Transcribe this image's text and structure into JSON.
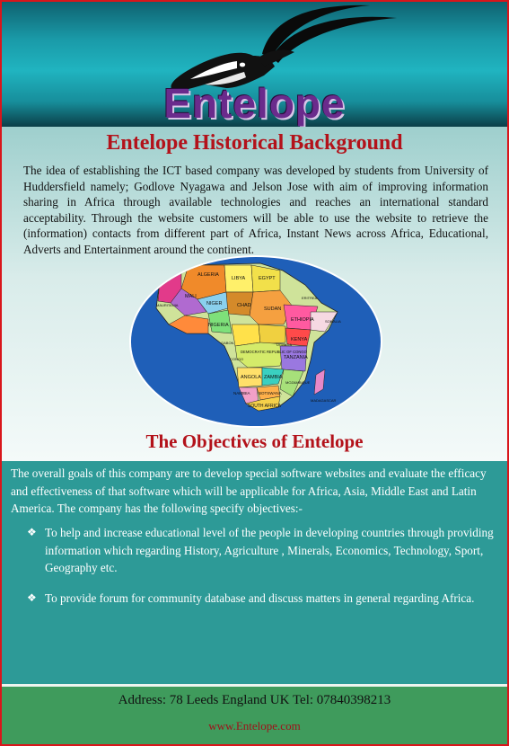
{
  "banner": {
    "brand": "Entelope"
  },
  "history": {
    "title": "Entelope Historical Background",
    "body": "The idea of establishing the ICT based company was developed by students from University of Huddersfield namely; Godlove Nyagawa and Jelson Jose with aim of improving information sharing in Africa through available technologies and reaches an international standard acceptability. Through the website customers will be able to use the website to retrieve the (information) contacts from different part of Africa, Instant News across Africa, Educational, Adverts and Entertainment around the continent."
  },
  "map": {
    "labels": [
      "ALGERIA",
      "LIBYA",
      "EGYPT",
      "MALI",
      "NIGER",
      "CHAD",
      "SUDAN",
      "NIGERIA",
      "ETHIOPIA",
      "SOMALIA",
      "KENYA",
      "DEMOCRATIC REPUBLIC OF CONGO",
      "TANZANIA",
      "ANGOLA",
      "ZAMBIA",
      "NAMIBIA",
      "BOTSWANA",
      "SOUTH AFRICA",
      "MAURITANIA",
      "ERITREA",
      "UGANDA",
      "MOZAMBIQUE",
      "MADAGASCAR",
      "GABON",
      "CONGO"
    ]
  },
  "objectives": {
    "title": "The Objectives of Entelope",
    "intro": "The overall goals of this company are to develop special software websites and evaluate the efficacy and effectiveness of that software which will be applicable for Africa, Asia, Middle East and Latin America.  The company has the following specify objectives:-",
    "items": [
      "To help and increase educational level of the people in developing countries through providing information which regarding  History,  Agriculture ,  Minerals, Economics, Technology,  Sport, Geography etc.",
      "To provide forum for community database and discuss matters in general regarding Africa."
    ],
    "bullet_symbol": "❖"
  },
  "footer": {
    "address": "Address: 78 Leeds England UK    Tel: 07840398213",
    "website": "www.Entelope.com"
  },
  "colors": {
    "border": "#d9161b",
    "title_red": "#b3121a",
    "teal": "#2d9a97",
    "footer_green": "#3f9b5c",
    "brand_purple": "#6a2b8c"
  }
}
